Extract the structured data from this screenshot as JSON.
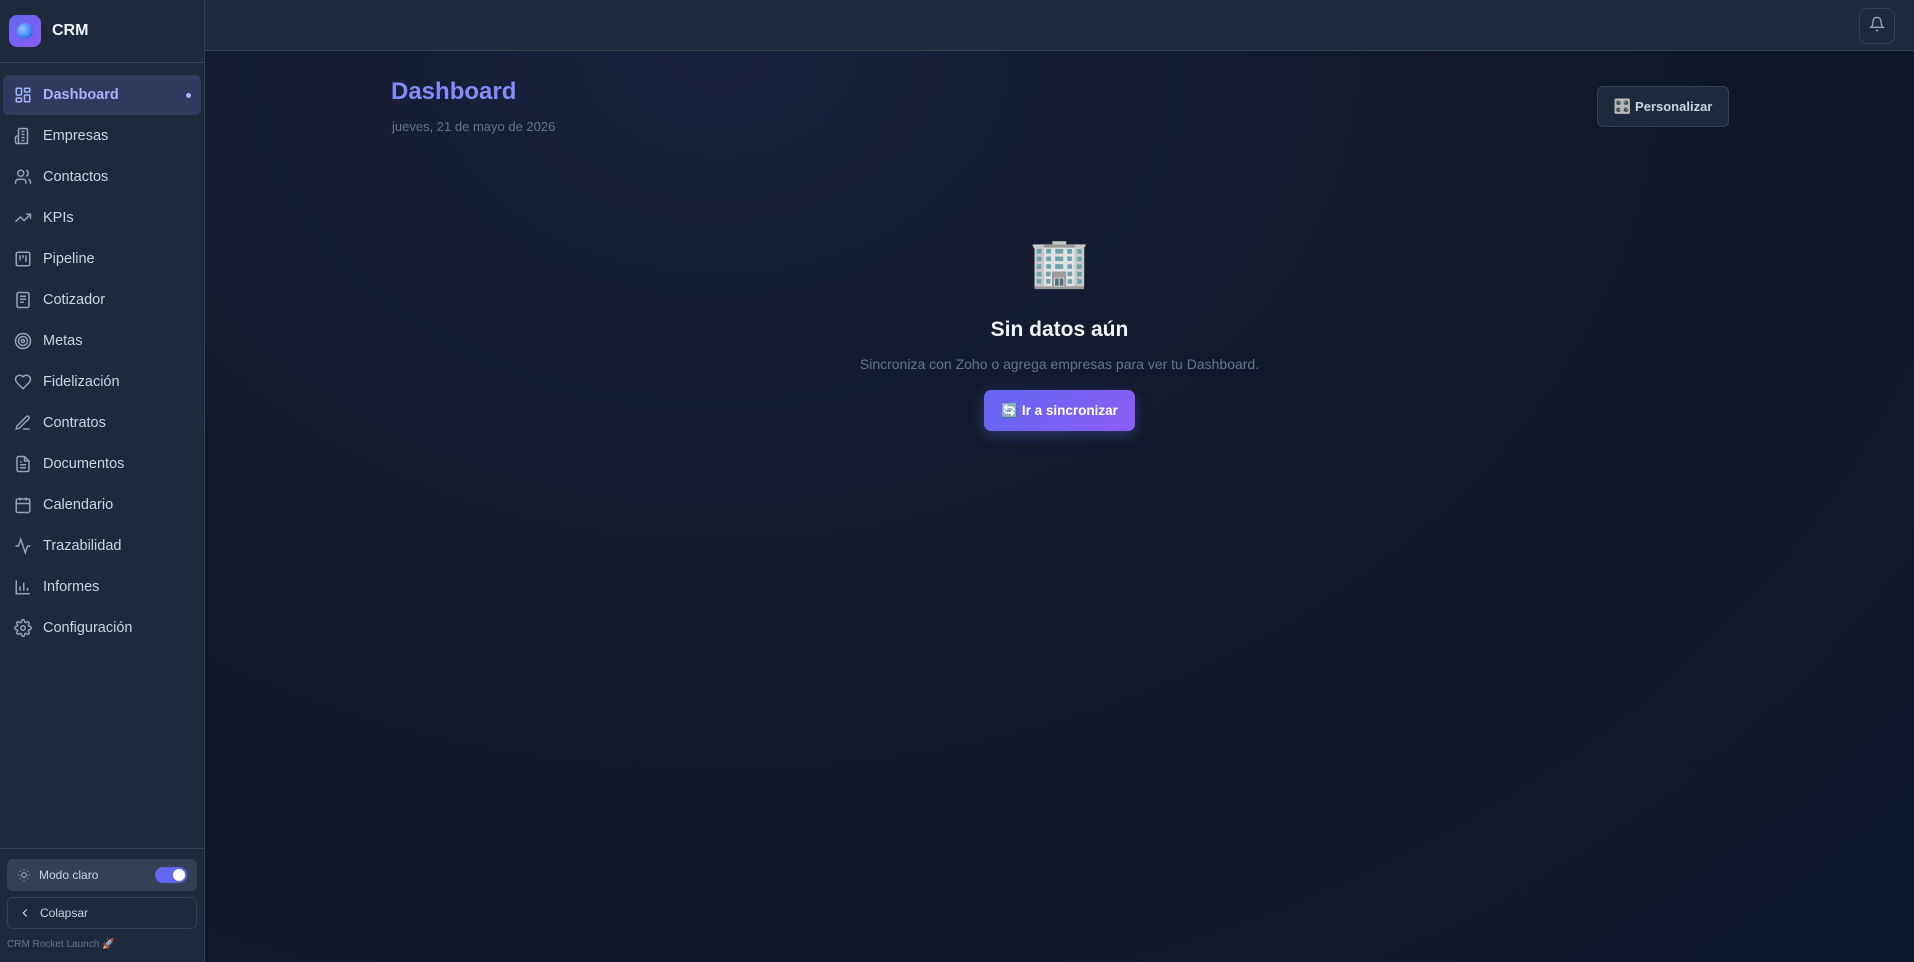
{
  "brand": {
    "name": "CRM"
  },
  "sidebar": {
    "items": [
      {
        "label": "Dashboard",
        "icon": "dashboard-grid-icon",
        "active": true
      },
      {
        "label": "Empresas",
        "icon": "building-icon"
      },
      {
        "label": "Contactos",
        "icon": "users-icon"
      },
      {
        "label": "KPIs",
        "icon": "trending-up-icon"
      },
      {
        "label": "Pipeline",
        "icon": "kanban-icon"
      },
      {
        "label": "Cotizador",
        "icon": "receipt-icon"
      },
      {
        "label": "Metas",
        "icon": "target-icon"
      },
      {
        "label": "Fidelización",
        "icon": "heart-icon"
      },
      {
        "label": "Contratos",
        "icon": "pen-icon"
      },
      {
        "label": "Documentos",
        "icon": "file-text-icon"
      },
      {
        "label": "Calendario",
        "icon": "calendar-icon"
      },
      {
        "label": "Trazabilidad",
        "icon": "activity-icon"
      },
      {
        "label": "Informes",
        "icon": "bar-chart-icon"
      },
      {
        "label": "Configuración",
        "icon": "settings-icon"
      }
    ],
    "theme_toggle_label": "Modo claro",
    "theme_toggle_on": true,
    "collapse_label": "Colapsar",
    "version": "CRM Rocket Launch 🚀"
  },
  "header": {
    "title": "Dashboard",
    "date": "jueves, 21 de mayo de 2026",
    "customize_label": "Personalizar",
    "customize_icon": "🎛️"
  },
  "empty_state": {
    "icon": "🏢",
    "title": "Sin datos aún",
    "description": "Sincroniza con Zoho o agrega empresas para ver tu Dashboard.",
    "button_label": "Ir a sincronizar",
    "button_icon": "🔄"
  },
  "colors": {
    "accent": "#6366f1",
    "accent_light": "#818cf8",
    "sidebar_bg": "#1e293b",
    "main_bg": "#0f172a"
  }
}
